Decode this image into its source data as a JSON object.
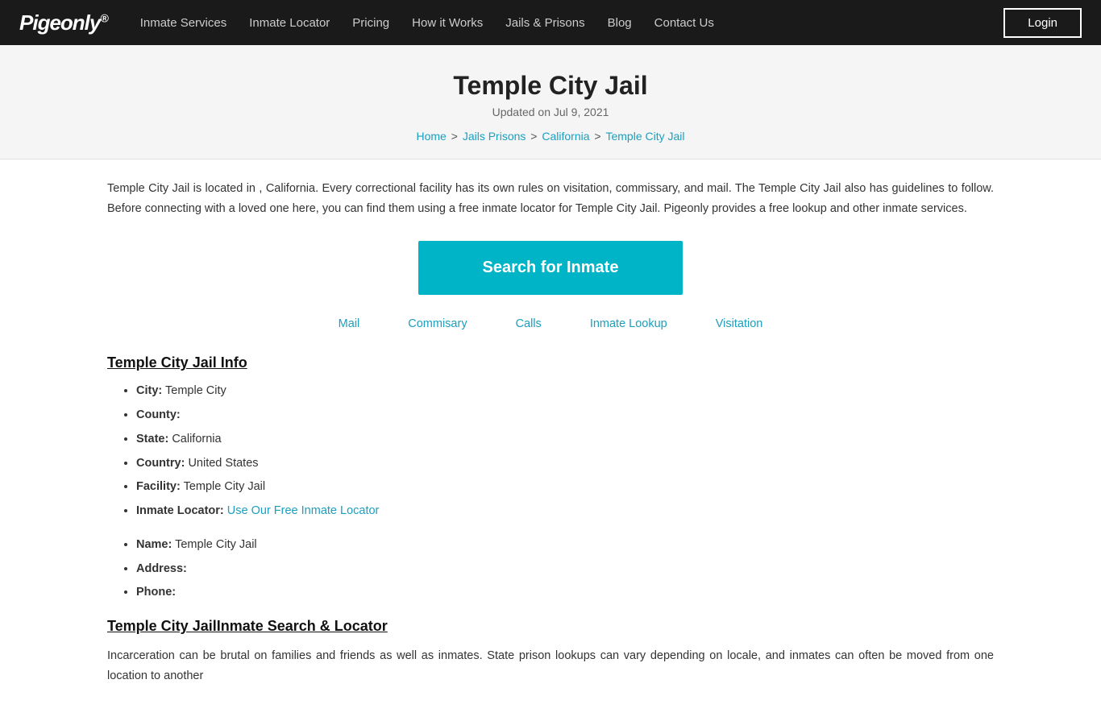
{
  "nav": {
    "logo": "Pigeonly",
    "logo_sup": "®",
    "links": [
      {
        "label": "Inmate Services",
        "name": "inmate-services-link"
      },
      {
        "label": "Inmate Locator",
        "name": "inmate-locator-link"
      },
      {
        "label": "Pricing",
        "name": "pricing-link"
      },
      {
        "label": "How it Works",
        "name": "how-it-works-link"
      },
      {
        "label": "Jails & Prisons",
        "name": "jails-prisons-link"
      },
      {
        "label": "Blog",
        "name": "blog-link"
      },
      {
        "label": "Contact Us",
        "name": "contact-us-link"
      }
    ],
    "login_label": "Login"
  },
  "header": {
    "title": "Temple City Jail",
    "updated": "Updated on Jul 9, 2021",
    "breadcrumb": {
      "home": "Home",
      "jails": "Jails Prisons",
      "state": "California",
      "current": "Temple City Jail"
    }
  },
  "description": "Temple City Jail is located in , California. Every correctional facility has its own rules on visitation, commissary, and mail. The Temple City Jail also has guidelines to follow. Before connecting with a loved one here, you can find them using a free inmate locator for Temple City Jail. Pigeonly provides a free lookup and other inmate services.",
  "search_btn": "Search for Inmate",
  "sub_nav": [
    {
      "label": "Mail",
      "name": "mail-tab"
    },
    {
      "label": "Commisary",
      "name": "commisary-tab"
    },
    {
      "label": "Calls",
      "name": "calls-tab"
    },
    {
      "label": "Inmate Lookup",
      "name": "inmate-lookup-tab"
    },
    {
      "label": "Visitation",
      "name": "visitation-tab"
    }
  ],
  "info_section": {
    "title": "Temple City Jail Info",
    "items": [
      {
        "label": "City:",
        "value": "Temple City"
      },
      {
        "label": "County:",
        "value": ""
      },
      {
        "label": "State:",
        "value": "California"
      },
      {
        "label": "Country:",
        "value": "United States"
      },
      {
        "label": "Facility:",
        "value": "Temple City Jail"
      },
      {
        "label": "Inmate Locator:",
        "value": "",
        "link": "Use Our Free Inmate Locator"
      }
    ]
  },
  "contact_section": {
    "items": [
      {
        "label": "Name:",
        "value": "Temple City Jail"
      },
      {
        "label": "Address:",
        "value": ""
      },
      {
        "label": "Phone:",
        "value": ""
      }
    ]
  },
  "search_section": {
    "title": "Temple City JailInmate Search & Locator",
    "description": "Incarceration can be brutal on families and friends as well as inmates. State prison lookups can vary depending on locale, and inmates can often be moved from one location to another"
  }
}
